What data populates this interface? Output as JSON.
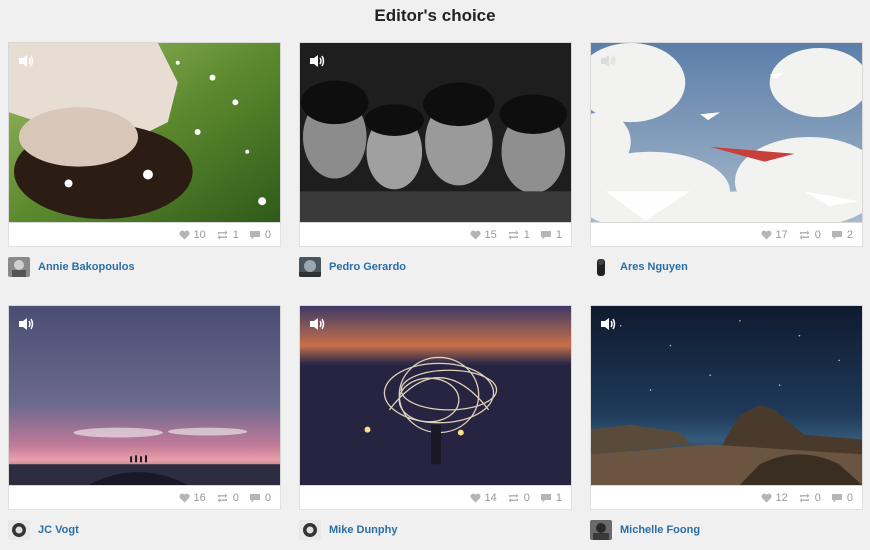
{
  "page": {
    "title": "Editor's choice"
  },
  "cards": [
    {
      "likes": "10",
      "reposts": "1",
      "comments": "0",
      "author": "Annie Bakopoulos",
      "scene": "grass-portrait"
    },
    {
      "likes": "15",
      "reposts": "1",
      "comments": "1",
      "author": "Pedro Gerardo",
      "scene": "bw-kids"
    },
    {
      "likes": "17",
      "reposts": "0",
      "comments": "2",
      "author": "Ares Nguyen",
      "scene": "clouds-planes"
    },
    {
      "likes": "16",
      "reposts": "0",
      "comments": "0",
      "author": "JC Vogt",
      "scene": "purple-sunset"
    },
    {
      "likes": "14",
      "reposts": "0",
      "comments": "1",
      "author": "Mike Dunphy",
      "scene": "light-painting"
    },
    {
      "likes": "12",
      "reposts": "0",
      "comments": "0",
      "author": "Michelle Foong",
      "scene": "night-rocks"
    }
  ],
  "icons": {
    "sound": "speaker-icon",
    "like": "heart-icon",
    "repost": "repost-icon",
    "comment": "comment-icon"
  },
  "colors": {
    "author_link": "#2a6ea6",
    "stat_text": "#999999"
  }
}
